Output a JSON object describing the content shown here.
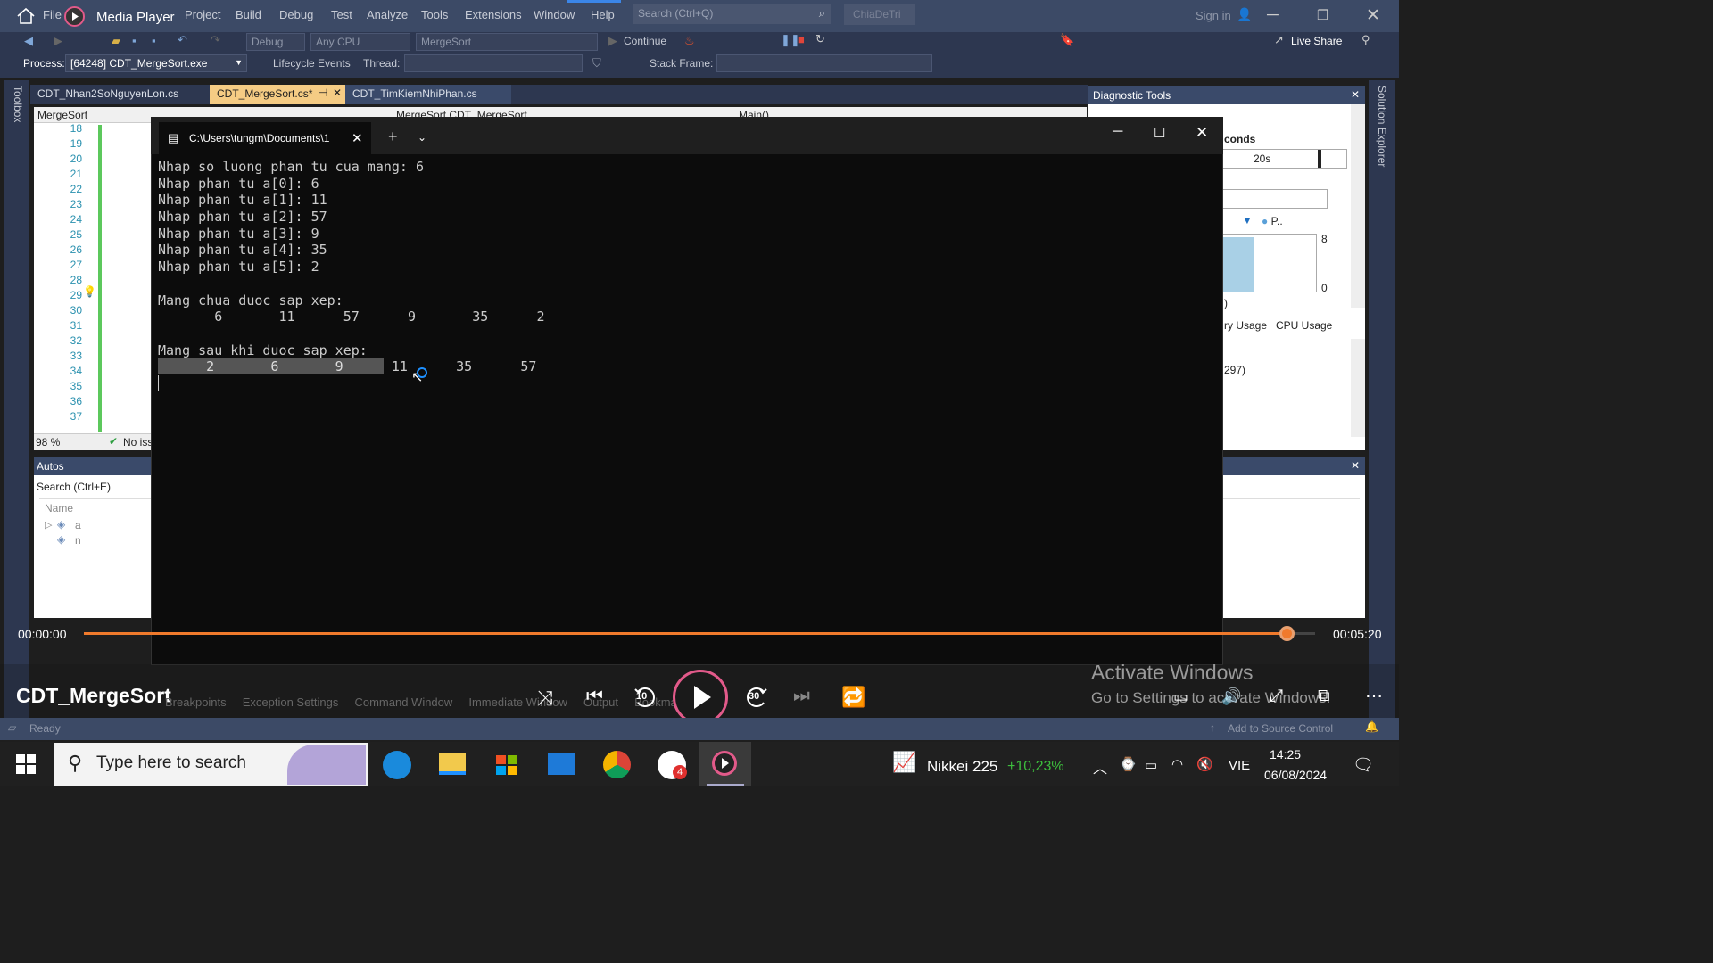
{
  "player": {
    "app_name": "Media Player",
    "video_title": "CDT_MergeSort",
    "time_current": "00:00:00",
    "time_total": "00:05:20",
    "progress_fraction": 0.977,
    "skip_back_label": "10",
    "skip_forward_label": "30"
  },
  "vs": {
    "menu": [
      "File",
      "Project",
      "Build",
      "Debug",
      "Test",
      "Analyze",
      "Tools",
      "Extensions",
      "Window",
      "Help"
    ],
    "search_placeholder": "Search (Ctrl+Q)",
    "solution_name": "ChiaDeTri",
    "sign_in": "Sign in",
    "config": "Debug",
    "platform": "Any CPU",
    "startup": "MergeSort",
    "continue_label": "Continue",
    "live_share": "Live Share",
    "process_label": "Process:",
    "process_value": "[64248] CDT_MergeSort.exe",
    "lifecycle_label": "Lifecycle Events",
    "thread_label": "Thread:",
    "stack_frame_label": "Stack Frame:",
    "tabs": [
      "CDT_Nhan2SoNguyenLon.cs",
      "CDT_MergeSort.cs*",
      "CDT_TimKiemNhiPhan.cs"
    ],
    "nav_project": "MergeSort",
    "nav_class": "MergeSort.CDT_MergeSort",
    "nav_member": "Main()",
    "line_numbers": [
      "18",
      "19",
      "20",
      "21",
      "22",
      "23",
      "24",
      "25",
      "26",
      "27",
      "28",
      "29",
      "30",
      "31",
      "32",
      "33",
      "34",
      "35",
      "36",
      "37"
    ],
    "zoom": "98 %",
    "no_issues": "No iss",
    "toolbox_label": "Toolbox",
    "solution_explorer_label": "Solution Explorer",
    "diagnostic_title": "Diagnostic Tools",
    "diag_seconds": "conds",
    "diag_time": "20s",
    "diag_legend": "P..",
    "diag_max": "8",
    "diag_min": "0",
    "diag_paren": ")",
    "diag_tab_memory": "ry Usage",
    "diag_tab_cpu": "CPU Usage",
    "diag_event": "297)",
    "autos_title": "Autos",
    "autos_search": "Search (Ctrl+E)",
    "autos_col_name": "Name",
    "autos_vars": [
      "a",
      "n"
    ],
    "bottom_tabs": [
      "Breakpoints",
      "Exception Settings",
      "Command Window",
      "Immediate Window",
      "Output",
      "Bookmarks"
    ],
    "status_ready": "Ready",
    "add_source_control": "Add to Source Control",
    "activate_title": "Activate Windows",
    "activate_sub": "Go to Settings to activate Windows."
  },
  "terminal": {
    "tab_title": "C:\\Users\\tungm\\Documents\\1",
    "lines": [
      "Nhap so luong phan tu cua mang: 6",
      "Nhap phan tu a[0]: 6",
      "Nhap phan tu a[1]: 11",
      "Nhap phan tu a[2]: 57",
      "Nhap phan tu a[3]: 9",
      "Nhap phan tu a[4]: 35",
      "Nhap phan tu a[5]: 2",
      "",
      "Mang chua duoc sap xep:",
      "       6       11      57      9       35      2",
      "",
      "Mang sau khi duoc sap xep:"
    ],
    "sorted_selected": "      2       6       9     ",
    "sorted_rest": " 11      35      57"
  },
  "taskbar": {
    "search_placeholder": "Type here to search",
    "stock_name": "Nikkei 225",
    "stock_change": "+10,23%",
    "language": "VIE",
    "time": "14:25",
    "date": "06/08/2024",
    "zalo_badge": "4"
  }
}
